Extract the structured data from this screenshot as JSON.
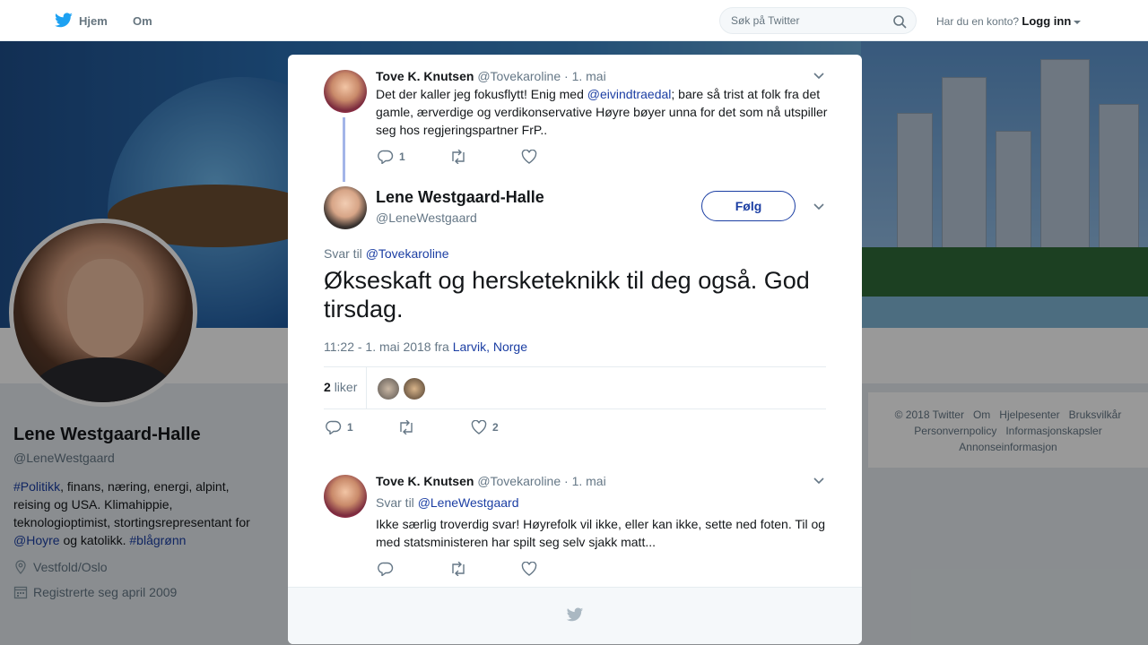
{
  "nav": {
    "home_label": "Hjem",
    "about_label": "Om",
    "search_placeholder": "Søk på Twitter",
    "account_prompt": "Har du en konto?",
    "login_label": "Logg inn"
  },
  "profile": {
    "name": "Lene Westgaard-Halle",
    "handle": "@LeneWestgaard",
    "bio_tag1": "#Politikk",
    "bio_text1": ", finans, næring, energi, alpint, reising og USA. Klimahippie, teknologioptimist, stortingsrepresentant for ",
    "bio_mention": "@Hoyre",
    "bio_text2": " og katolikk. ",
    "bio_tag2": "#blågrønn",
    "location": "Vestfold/Oslo",
    "joined": "Registrerte seg april 2009"
  },
  "footer": {
    "copyright": "© 2018 Twitter",
    "about": "Om",
    "help": "Hjelpesenter",
    "terms": "Bruksvilkår",
    "privacy": "Personvernpolicy",
    "cookies": "Informasjonskapsler",
    "ads": "Annonseinformasjon"
  },
  "parent_tweet": {
    "name": "Tove K. Knutsen",
    "handle": "@Tovekaroline",
    "date": "· 1. mai",
    "text_before": "Det der kaller jeg fokusflytt! Enig med ",
    "mention": "@eivindtraedal",
    "text_after": "; bare så trist at folk fra det gamle, ærverdige og verdikonservative Høyre bøyer unna for det som nå utspiller seg hos regjeringspartner FrP..",
    "reply_count": "1"
  },
  "main_tweet": {
    "name": "Lene Westgaard-Halle",
    "handle": "@LeneWestgaard",
    "follow_label": "Følg",
    "reply_prefix": "Svar til",
    "reply_to": "@Tovekaroline",
    "text": "Økseskaft og hersketeknikk til deg også. God tirsdag.",
    "timestamp": "11:22 - 1. mai 2018 fra",
    "location": "Larvik, Norge",
    "likes_count": "2",
    "likes_label": "liker",
    "reply_count": "1",
    "like_count": "2"
  },
  "reply_tweet": {
    "name": "Tove K. Knutsen",
    "handle": "@Tovekaroline",
    "date": "· 1. mai",
    "reply_prefix": "Svar til",
    "reply_to": "@LeneWestgaard",
    "text": "Ikke særlig troverdig svar! Høyrefolk vil ikke, eller kan ikke, sette ned foten. Til og med statsministeren har spilt seg selv sjakk matt..."
  },
  "colors": {
    "link": "#1b3ea3",
    "twitter_blue": "#1da1f2",
    "muted": "#657786"
  }
}
